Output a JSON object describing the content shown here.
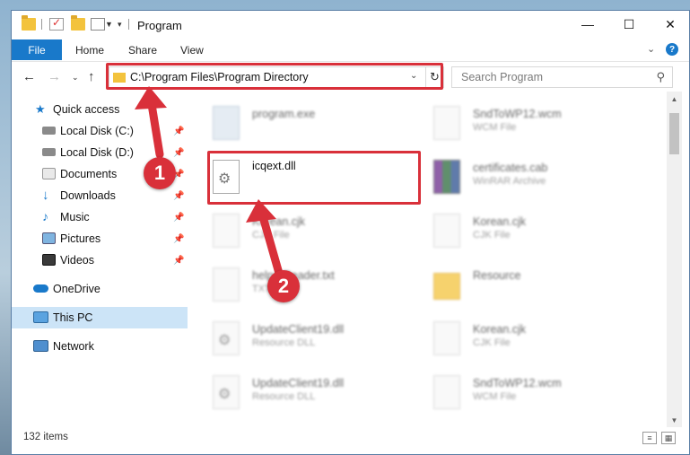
{
  "window": {
    "title": "Program"
  },
  "ribbon": {
    "tabs": [
      "File",
      "Home",
      "Share",
      "View"
    ]
  },
  "address": {
    "path": "C:\\Program Files\\Program Directory"
  },
  "search": {
    "placeholder": "Search Program"
  },
  "sidebar": {
    "items": [
      {
        "label": "Quick access",
        "icon": "star-icon",
        "pinned": false
      },
      {
        "label": "Local Disk (C:)",
        "icon": "drive-icon",
        "pinned": true
      },
      {
        "label": "Local Disk (D:)",
        "icon": "drive-icon",
        "pinned": true
      },
      {
        "label": "Documents",
        "icon": "documents-icon",
        "pinned": true
      },
      {
        "label": "Downloads",
        "icon": "download-icon",
        "pinned": true
      },
      {
        "label": "Music",
        "icon": "music-icon",
        "pinned": true
      },
      {
        "label": "Pictures",
        "icon": "pictures-icon",
        "pinned": true
      },
      {
        "label": "Videos",
        "icon": "videos-icon",
        "pinned": true
      },
      {
        "label": "OneDrive",
        "icon": "cloud-icon",
        "pinned": false
      },
      {
        "label": "This PC",
        "icon": "computer-icon",
        "pinned": false,
        "selected": true
      },
      {
        "label": "Network",
        "icon": "network-icon",
        "pinned": false
      }
    ]
  },
  "files": [
    {
      "name": "program.exe",
      "type": "",
      "icon": "exe-icon"
    },
    {
      "name": "SndToWP12.wcm",
      "type": "WCM File",
      "icon": "file-icon"
    },
    {
      "name": "icqext.dll",
      "type": "",
      "icon": "dll-icon",
      "highlighted": true
    },
    {
      "name": "certificates.cab",
      "type": "WinRAR Archive",
      "icon": "archive-icon"
    },
    {
      "name": "Korean.cjk",
      "type": "CJK File",
      "icon": "file-icon"
    },
    {
      "name": "Korean.cjk",
      "type": "CJK File",
      "icon": "file-icon"
    },
    {
      "name": "helperReader.txt",
      "type": "TXT File",
      "icon": "file-icon"
    },
    {
      "name": "Resource",
      "type": "",
      "icon": "folder-icon"
    },
    {
      "name": "UpdateClient19.dll",
      "type": "Resource DLL",
      "icon": "dll-icon"
    },
    {
      "name": "Korean.cjk",
      "type": "CJK File",
      "icon": "file-icon"
    },
    {
      "name": "UpdateClient19.dll",
      "type": "Resource DLL",
      "icon": "dll-icon"
    },
    {
      "name": "SndToWP12.wcm",
      "type": "WCM File",
      "icon": "file-icon"
    }
  ],
  "status": {
    "item_count": "132 items"
  },
  "steps": [
    "1",
    "2"
  ],
  "colors": {
    "accent": "#1979ca",
    "highlight": "#d9303a",
    "selection": "#cce4f7"
  }
}
